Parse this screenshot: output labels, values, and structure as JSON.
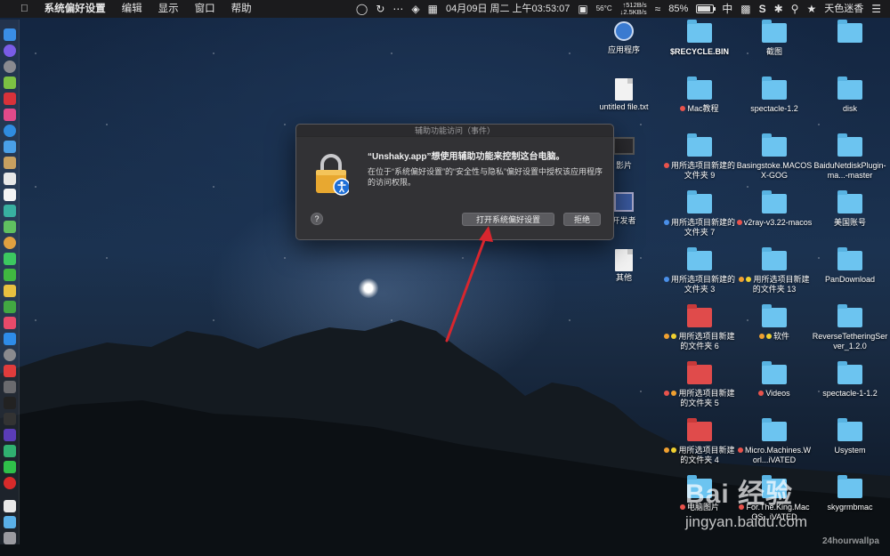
{
  "menubar": {
    "apple": "",
    "app_name": "系统偏好设置",
    "menus": [
      "编辑",
      "显示",
      "窗口",
      "帮助"
    ],
    "temp": "56°C",
    "net_up": "↑512B/s",
    "net_down": "↓2.5KB/s",
    "datetime": "04月09日 周二 上午03:53:07",
    "battery": "85%",
    "ime": "中",
    "user": "天色迷香"
  },
  "dialog": {
    "window_title": "辅助功能访问（事件）",
    "title": "“Unshaky.app”想使用辅助功能来控制这台电脑。",
    "body": "在位于“系统偏好设置”的“安全性与隐私”偏好设置中授权该应用程序的访问权限。",
    "help_label": "?",
    "open_prefs_label": "打开系统偏好设置",
    "deny_label": "拒绝"
  },
  "desktop": {
    "items": [
      {
        "label": "应用程序"
      },
      {
        "label": "$RECYCLE.BIN"
      },
      {
        "label": "截图"
      },
      {
        "label": "untitled file.txt"
      },
      {
        "label": "Mac教程"
      },
      {
        "label": "spectacle-1.2"
      },
      {
        "label": "disk"
      },
      {
        "label": "影片"
      },
      {
        "label": "用所选项目新建的文件夹 9"
      },
      {
        "label": "Basingstoke.MACOSX-GOG"
      },
      {
        "label": "BaiduNetdiskPlugin-ma...-master"
      },
      {
        "label": "开发者"
      },
      {
        "label": "用所选项目新建的文件夹 7"
      },
      {
        "label": "v2ray-v3.22-macos"
      },
      {
        "label": "美国账号"
      },
      {
        "label": "其他"
      },
      {
        "label": "用所选项目新建的文件夹 3"
      },
      {
        "label": "用所选项目新建的文件夹 13"
      },
      {
        "label": "PanDownload"
      },
      {
        "label": "用所选项目新建的文件夹 6"
      },
      {
        "label": "软件"
      },
      {
        "label": "ReverseTetheringServer_1.2.0"
      },
      {
        "label": "用所选项目新建的文件夹 5"
      },
      {
        "label": "Videos"
      },
      {
        "label": "spectacle-1-1.2"
      },
      {
        "label": "用所选项目新建的文件夹 4"
      },
      {
        "label": "Micro.Machines.Worl...iVATED"
      },
      {
        "label": "Usystem"
      },
      {
        "label": "电脑图片"
      },
      {
        "label": "For.The.King.MacOS...iVATED"
      },
      {
        "label": "skygrmbmac"
      }
    ]
  },
  "watermark": {
    "logo": "Bai 经验",
    "url": "jingyan.baidu.com",
    "corner": "24hourwallpa"
  },
  "colors": {
    "folder_blue": "#6cc4f0",
    "folder_red": "#e04b4b",
    "tag_red": "#e8534c",
    "tag_blue": "#4a8fe8",
    "tag_orange": "#f0a030",
    "tag_yellow": "#f0d030",
    "arrow_red": "#d8262e"
  }
}
